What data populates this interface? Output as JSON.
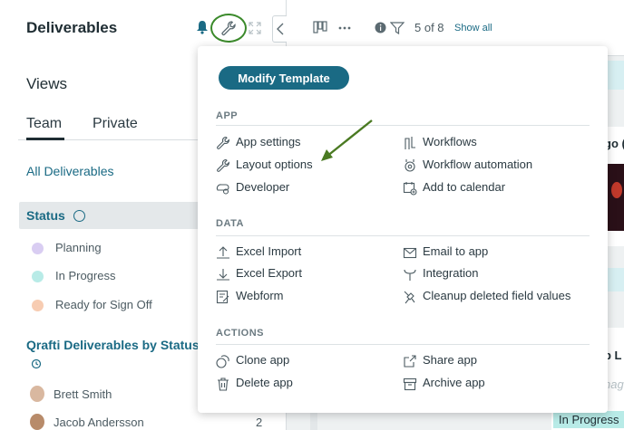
{
  "sidebar": {
    "title": "Deliverables",
    "views_heading": "Views",
    "tabs": [
      {
        "label": "Team"
      },
      {
        "label": "Private"
      }
    ],
    "all_link": "All Deliverables",
    "status_group": {
      "label": "Status"
    },
    "statuses": [
      {
        "label": "Planning",
        "color": "#d9cdf2"
      },
      {
        "label": "In Progress",
        "color": "#b8ebe7"
      },
      {
        "label": "Ready for Sign Off",
        "color": "#f7ccb2"
      }
    ],
    "group_title": "Qrafti Deliverables by Status",
    "people": [
      {
        "name": "Brett Smith",
        "count": ""
      },
      {
        "name": "Jacob Andersson",
        "count": "2"
      }
    ]
  },
  "toolbar": {
    "filter_count": "5 of 8",
    "show_all": "Show all"
  },
  "board": {
    "card_text_1": "go (",
    "card_text_2": "p L",
    "card_text_3": "nag",
    "badge": "In Progress"
  },
  "popover": {
    "modify_button": "Modify Template",
    "sections": [
      {
        "heading": "APP",
        "left": [
          {
            "label": "App settings",
            "icon": "wrench-icon"
          },
          {
            "label": "Layout options",
            "icon": "wrench-icon"
          },
          {
            "label": "Developer",
            "icon": "developer-icon"
          }
        ],
        "right": [
          {
            "label": "Workflows",
            "icon": "workflows-icon"
          },
          {
            "label": "Workflow automation",
            "icon": "automation-icon"
          },
          {
            "label": "Add to calendar",
            "icon": "calendar-icon"
          }
        ]
      },
      {
        "heading": "DATA",
        "left": [
          {
            "label": "Excel Import",
            "icon": "upload-icon"
          },
          {
            "label": "Excel Export",
            "icon": "download-icon"
          },
          {
            "label": "Webform",
            "icon": "webform-icon"
          }
        ],
        "right": [
          {
            "label": "Email to app",
            "icon": "email-icon"
          },
          {
            "label": "Integration",
            "icon": "integration-icon"
          },
          {
            "label": "Cleanup deleted field values",
            "icon": "cleanup-icon"
          }
        ]
      },
      {
        "heading": "ACTIONS",
        "left": [
          {
            "label": "Clone app",
            "icon": "clone-icon"
          },
          {
            "label": "Delete app",
            "icon": "trash-icon"
          }
        ],
        "right": [
          {
            "label": "Share app",
            "icon": "share-icon"
          },
          {
            "label": "Archive app",
            "icon": "archive-icon"
          }
        ]
      }
    ]
  },
  "colors": {
    "accent": "#1a6a84",
    "highlight_circle": "#3b8a2b",
    "annotation_arrow": "#4a7a22"
  }
}
